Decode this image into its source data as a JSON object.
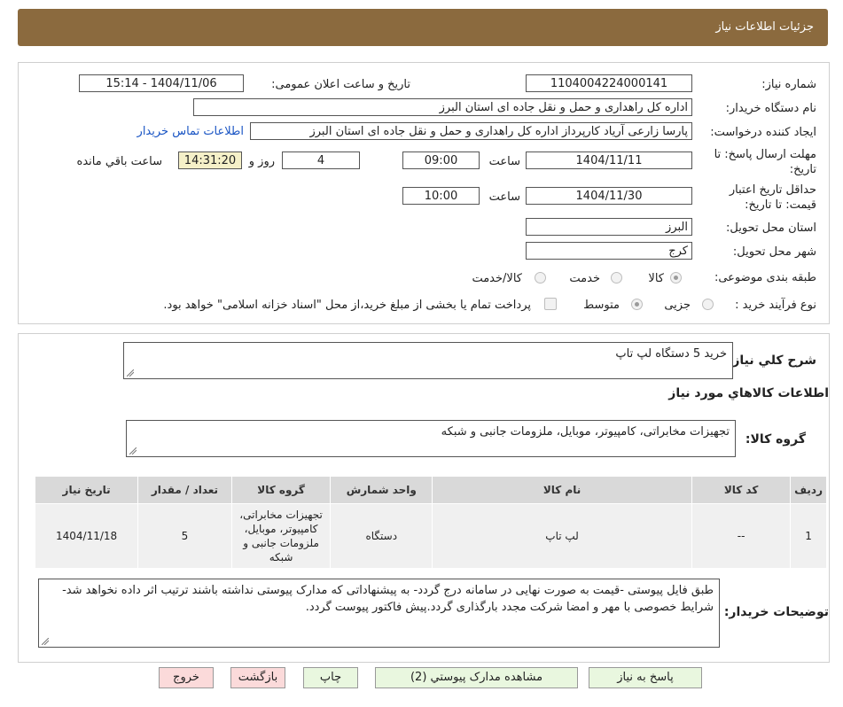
{
  "header": {
    "title": "جزئیات اطلاعات نیاز"
  },
  "form": {
    "need_number_label": "شماره نیاز:",
    "need_number": "1104004224000141",
    "announce_label": "تاریخ و ساعت اعلان عمومی:",
    "announce_value": "1404/11/06 - 15:14",
    "buyer_org_label": "نام دستگاه خریدار:",
    "buyer_org": "اداره کل راهداری و حمل و نقل جاده ای استان البرز",
    "requester_label": "ایجاد کننده درخواست:",
    "requester": "پارسا زارعی آریاد کارپرداز اداره کل راهداری و حمل و نقل جاده ای استان البرز",
    "contact_link": "اطلاعات تماس خریدار",
    "deadline_label_1": "مهلت ارسال پاسخ: تا",
    "deadline_label_2": "تاریخ:",
    "deadline_date": "1404/11/11",
    "time_label": "ساعت",
    "deadline_time": "09:00",
    "days_value": "4",
    "days_label": "روز و",
    "remaining_time": "14:31:20",
    "remaining_label": "ساعت باقي مانده",
    "validity_label_1": "حداقل تاریخ اعتبار",
    "validity_label_2": "قیمت: تا تاریخ:",
    "validity_date": "1404/11/30",
    "validity_time": "10:00",
    "province_label": "استان محل تحویل:",
    "province": "البرز",
    "city_label": "شهر محل تحویل:",
    "city": "کرج",
    "category_label": "طبقه بندی موضوعی:",
    "category_options": [
      "کالا",
      "خدمت",
      "کالا/خدمت"
    ],
    "process_label": "نوع فرآیند خرید :",
    "process_options": [
      "جزیی",
      "متوسط"
    ],
    "payment_note": "پرداخت تمام یا بخشی از مبلغ خرید،از محل \"اسناد خزانه اسلامی\" خواهد بود."
  },
  "details": {
    "summary_label": "شرح کلي نياز:",
    "summary": "خرید 5 دستگاه لپ تاپ",
    "items_title": "اطلاعات کالاهاي مورد نياز",
    "group_label": "گروه کالا:",
    "group_value": "تجهیزات مخابراتی، کامپیوتر، موبایل، ملزومات جانبی و شبکه",
    "table": {
      "headers": [
        "رديف",
        "کد کالا",
        "نام کالا",
        "واحد شمارش",
        "گروه کالا",
        "تعداد / مقدار",
        "تاریخ نیاز"
      ],
      "rows": [
        [
          "1",
          "--",
          "لپ تاپ",
          "دستگاه",
          "تجهیزات مخابراتی، کامپیوتر، موبایل، ملزومات جانبی و شبکه",
          "5",
          "1404/11/18"
        ]
      ]
    },
    "notes_label": "توضیحات خریدار:",
    "notes": "طبق فایل پیوستی -قیمت به صورت نهایی در سامانه درج گردد- به پیشنهاداتی که مدارک پیوستی نداشته باشند ترتیب اثر داده نخواهد شد- شرایط خصوصی با مهر و امضا شرکت مجدد بارگذاری گردد.پیش فاکتور پیوست گردد."
  },
  "buttons": {
    "reply": "پاسخ به نیاز",
    "attachments": "مشاهده مدارک پیوستي (2)",
    "print": "چاپ",
    "back": "بازگشت",
    "exit": "خروج"
  },
  "watermark": {
    "text": "AriaTender.neT"
  },
  "colors": {
    "header": "#8b6a3e",
    "link": "#1a55c4",
    "highlight": "#f5f0c8"
  }
}
